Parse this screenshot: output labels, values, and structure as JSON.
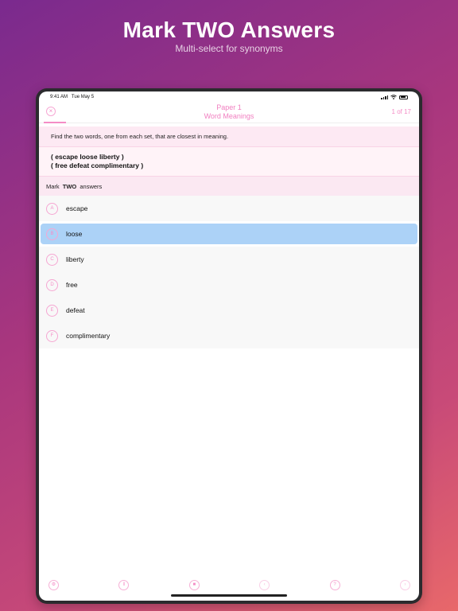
{
  "promo": {
    "title": "Mark TWO Answers",
    "subtitle": "Multi-select for synonyms"
  },
  "status_bar": {
    "time": "9:41 AM",
    "date": "Tue May 5"
  },
  "nav": {
    "close_icon": "×",
    "title_line1": "Paper 1",
    "title_line2": "Word Meanings",
    "counter": "1 of 17"
  },
  "question": {
    "instructions": "Find the two words, one from each set, that are closest in meaning.",
    "set1": "( escape loose liberty )",
    "set2": "( free defeat complimentary )",
    "mark_prefix": "Mark",
    "mark_count": "TWO",
    "mark_suffix": "answers"
  },
  "options": [
    {
      "letter": "A",
      "text": "escape",
      "selected": false
    },
    {
      "letter": "B",
      "text": "loose",
      "selected": true
    },
    {
      "letter": "C",
      "text": "liberty",
      "selected": false
    },
    {
      "letter": "D",
      "text": "free",
      "selected": false
    },
    {
      "letter": "E",
      "text": "defeat",
      "selected": false
    },
    {
      "letter": "F",
      "text": "complimentary",
      "selected": false
    }
  ],
  "toolbar": {
    "settings_icon": "⚙",
    "pause_icon": "‖",
    "bookmark_icon": "■",
    "prev_icon": "‹",
    "help_label": "?",
    "next_icon": "›"
  },
  "colors": {
    "accent": "#f48cc6",
    "selected": "#acd2f7"
  }
}
